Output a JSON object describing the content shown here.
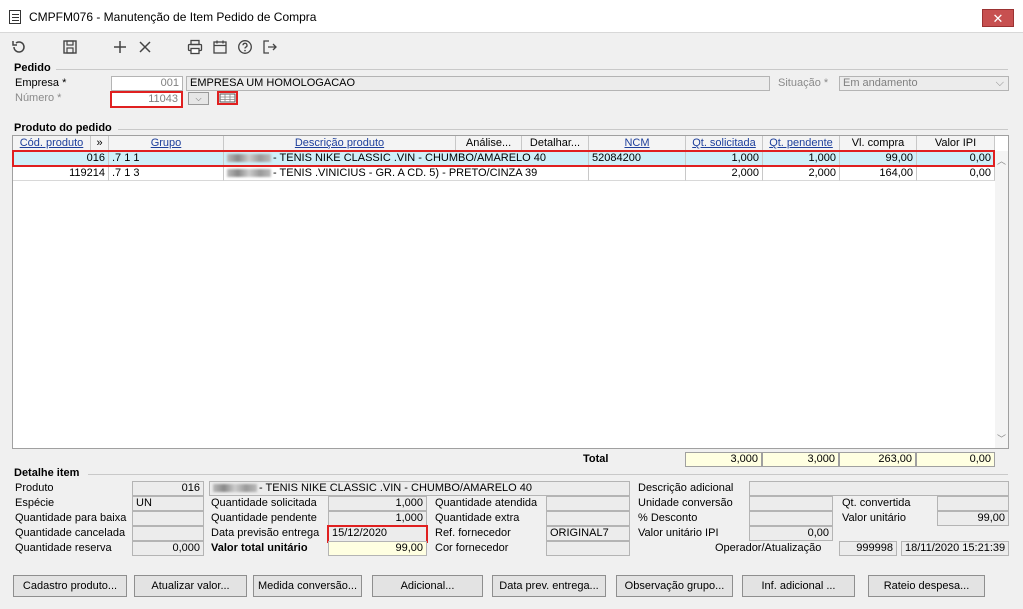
{
  "window": {
    "title": "CMPFM076 - Manutenção de Item Pedido de Compra",
    "close": "✕"
  },
  "toolbar": [
    "undo-icon",
    "save-icon",
    "add-icon",
    "close-icon",
    "print-icon",
    "calendar-icon",
    "help-icon",
    "exit-icon"
  ],
  "pedido": {
    "section": "Pedido",
    "empresa_label": "Empresa *",
    "empresa_code": "001",
    "empresa_name": "EMPRESA UM HOMOLOGACAO",
    "numero_label": "Número *",
    "numero_value": "11043",
    "situacao_label": "Situação *",
    "situacao_value": "Em andamento"
  },
  "produto": {
    "section": "Produto do pedido",
    "headers": [
      "Cód. produto",
      "»",
      "Grupo",
      "Descrição produto",
      "Análise...",
      "Detalhar...",
      "NCM",
      "Qt. solicitada",
      "Qt. pendente",
      "Vl. compra",
      "Valor IPI"
    ],
    "rows": [
      {
        "cod": "016",
        "grupo": ".7 1 1",
        "descricao": "- TENIS NIKE CLASSIC .VIN - CHUMBO/AMARELO 40",
        "ncm": "52084200",
        "qt_solicitada": "1,000",
        "qt_pendente": "1,000",
        "vl_compra": "99,00",
        "valor_ipi": "0,00"
      },
      {
        "cod": "119214",
        "grupo": ".7 1 3",
        "descricao": "- TENIS  .VINICIUS - GR. A CD. 5) - PRETO/CINZA 39",
        "ncm": "",
        "qt_solicitada": "2,000",
        "qt_pendente": "2,000",
        "vl_compra": "164,00",
        "valor_ipi": "0,00"
      }
    ],
    "total_label": "Total",
    "totals": {
      "qt_solicitada": "3,000",
      "qt_pendente": "3,000",
      "vl_compra": "263,00",
      "valor_ipi": "0,00"
    }
  },
  "detalhe": {
    "section": "Detalhe item",
    "produto_label": "Produto",
    "produto_code": "016",
    "produto_desc": "- TENIS NIKE CLASSIC .VIN - CHUMBO/AMARELO 40",
    "especie_label": "Espécie",
    "especie_value": "UN",
    "qtd_baixa_label": "Quantidade para baixa",
    "qtd_cancelada_label": "Quantidade cancelada",
    "qtd_reserva_label": "Quantidade reserva",
    "qtd_reserva_value": "0,000",
    "qtd_solicitada_label": "Quantidade solicitada",
    "qtd_solicitada_value": "1,000",
    "qtd_pendente_label": "Quantidade pendente",
    "qtd_pendente_value": "1,000",
    "data_previsao_label": "Data previsão entrega",
    "data_previsao_value": "15/12/2020",
    "valor_total_label": "Valor total unitário",
    "valor_total_value": "99,00",
    "qtd_atendida_label": "Quantidade atendida",
    "qtd_extra_label": "Quantidade extra",
    "ref_fornecedor_label": "Ref. fornecedor",
    "ref_fornecedor_value": "ORIGINAL7",
    "cor_fornecedor_label": "Cor fornecedor",
    "desc_adicional_label": "Descrição adicional",
    "unidade_conversao_label": "Unidade conversão",
    "desconto_label": "% Desconto",
    "valor_unitario_ipi_label": "Valor unitário IPI",
    "valor_unitario_ipi_value": "0,00",
    "qt_convertida_label": "Qt. convertida",
    "valor_unitario_label": "Valor unitário",
    "valor_unitario_value": "99,00",
    "operador_label": "Operador/Atualização",
    "operador_value": "999998",
    "atualizacao_value": "18/11/2020 15:21:39"
  },
  "buttons": [
    "Cadastro produto...",
    "Atualizar valor...",
    "Medida conversão...",
    "Adicional...",
    "Data prev. entrega...",
    "Observação grupo...",
    "Inf. adicional ...",
    "Rateio despesa..."
  ]
}
